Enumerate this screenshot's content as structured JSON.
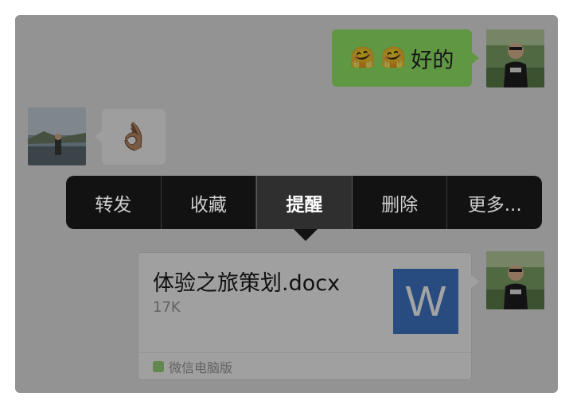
{
  "chat": {
    "sent_message": {
      "emojis": [
        "🤗",
        "🤗"
      ],
      "text": "好的"
    },
    "received_message": {
      "emoji": "👌🏽"
    },
    "file_message": {
      "file_name": "体验之旅策划.docx",
      "file_size": "17K",
      "file_type_letter": "W",
      "source": "微信电脑版"
    }
  },
  "context_menu": {
    "items": [
      {
        "label": "转发"
      },
      {
        "label": "收藏"
      },
      {
        "label": "提醒",
        "active": true
      },
      {
        "label": "删除"
      },
      {
        "label": "更多..."
      }
    ]
  },
  "colors": {
    "sent_bubble": "#95ec69",
    "menu_background": "#121212",
    "word_icon": "#3f77c7"
  }
}
